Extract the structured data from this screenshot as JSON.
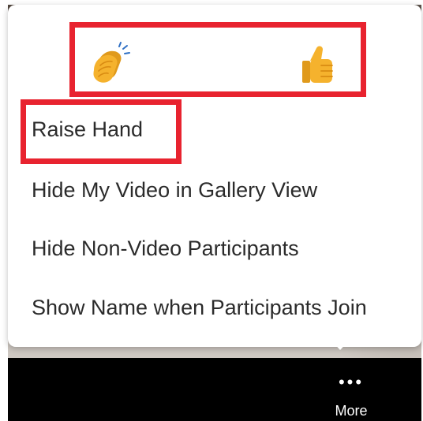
{
  "reactions": {
    "clap": {
      "icon": "clapping-hands-icon"
    },
    "thumbs_up": {
      "icon": "thumbs-up-icon"
    }
  },
  "menu": {
    "items": [
      {
        "label": "Raise Hand"
      },
      {
        "label": "Hide My Video in Gallery View"
      },
      {
        "label": "Hide Non-Video Participants"
      },
      {
        "label": "Show Name when Participants Join"
      }
    ]
  },
  "toolbar": {
    "more": {
      "label": "More",
      "icon": "more-dots-icon"
    }
  },
  "colors": {
    "highlight": "#e8232f",
    "emoji": "#f5b22d",
    "toolbar": "#000000"
  }
}
